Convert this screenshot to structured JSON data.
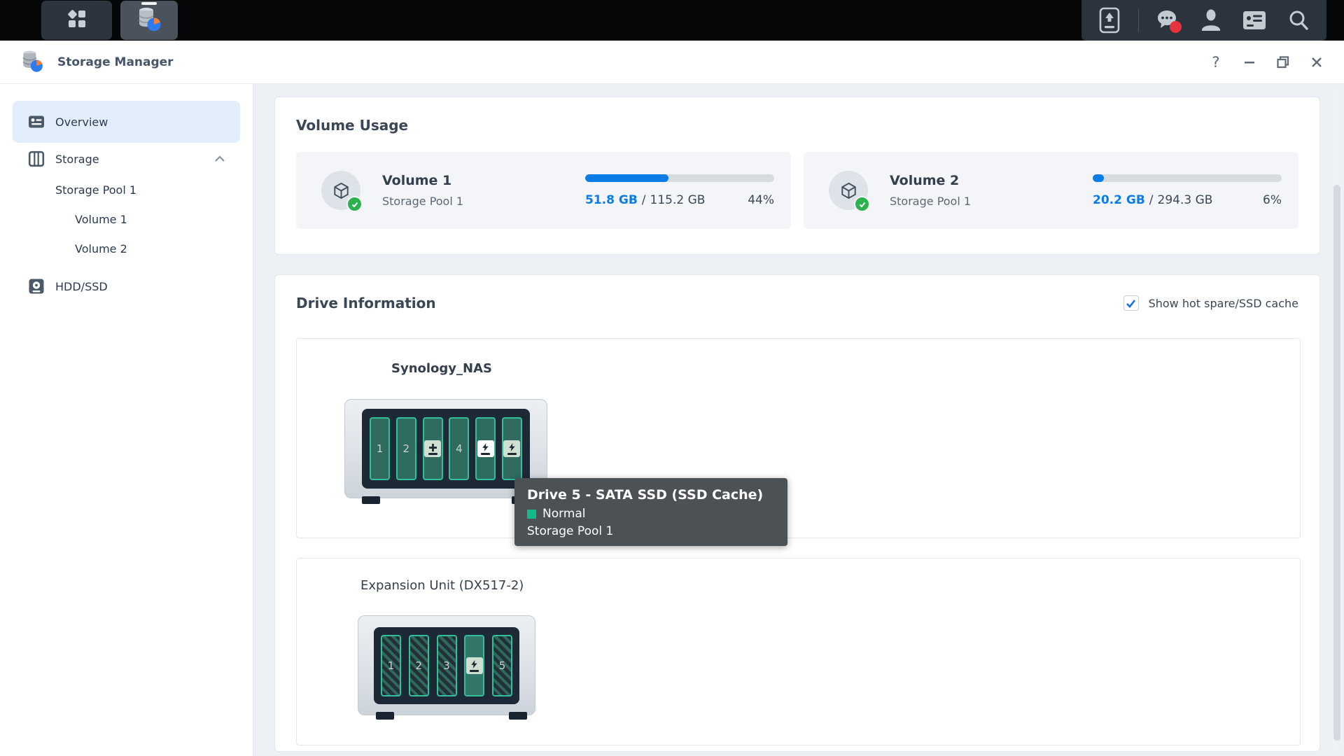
{
  "taskbar": {
    "apps": [
      {
        "name": "Main Menu"
      },
      {
        "name": "Storage Manager",
        "active": true
      }
    ],
    "tray_icons": [
      "external-device",
      "chat",
      "user",
      "widgets",
      "search"
    ],
    "chat_has_notification": true
  },
  "window": {
    "title": "Storage Manager",
    "controls": {
      "help": "?",
      "minimize": "minimize",
      "maximize": "maximize",
      "close": "close"
    }
  },
  "sidebar": {
    "items": [
      {
        "label": "Overview",
        "selected": true
      },
      {
        "label": "Storage",
        "expanded": true
      },
      {
        "label": "Storage Pool 1",
        "indent": 1
      },
      {
        "label": "Volume 1",
        "indent": 2
      },
      {
        "label": "Volume 2",
        "indent": 2
      },
      {
        "label": "HDD/SSD"
      }
    ]
  },
  "volume_usage": {
    "title": "Volume Usage",
    "volumes": [
      {
        "name": "Volume 1",
        "pool": "Storage Pool 1",
        "used": "51.8 GB",
        "slash": "/",
        "total": "115.2 GB",
        "percent": "44%",
        "percent_value": 44,
        "status": "healthy"
      },
      {
        "name": "Volume 2",
        "pool": "Storage Pool 1",
        "used": "20.2 GB",
        "slash": "/",
        "total": "294.3 GB",
        "percent": "6%",
        "percent_value": 6,
        "status": "healthy"
      }
    ]
  },
  "drive_information": {
    "title": "Drive Information",
    "filter_label": "Show hot spare/SSD cache",
    "filter_checked": true,
    "units": [
      {
        "name": "Synology_NAS",
        "bays": [
          {
            "label": "1",
            "type": "drive"
          },
          {
            "label": "2",
            "type": "drive"
          },
          {
            "label": "",
            "type": "hot-spare"
          },
          {
            "label": "4",
            "type": "drive"
          },
          {
            "label": "",
            "type": "ssd-cache-hover"
          },
          {
            "label": "",
            "type": "ssd-cache"
          }
        ]
      },
      {
        "name": "Expansion Unit (DX517-2)",
        "bays": [
          {
            "label": "1",
            "type": "drive-hatched"
          },
          {
            "label": "2",
            "type": "drive-hatched"
          },
          {
            "label": "3",
            "type": "drive-hatched"
          },
          {
            "label": "",
            "type": "ssd-cache"
          },
          {
            "label": "5",
            "type": "drive-hatched"
          }
        ]
      }
    ],
    "tooltip": {
      "title": "Drive 5 - SATA SSD (SSD Cache)",
      "status": "Normal",
      "pool": "Storage Pool 1"
    }
  },
  "colors": {
    "accent_blue": "#0b7ce6",
    "teal_border": "#32bf9c",
    "green_ok": "#2db14e",
    "tooltip_status_green": "#12b98a",
    "taskbar_black": "#040608",
    "tray_slate": "#2b333d"
  }
}
